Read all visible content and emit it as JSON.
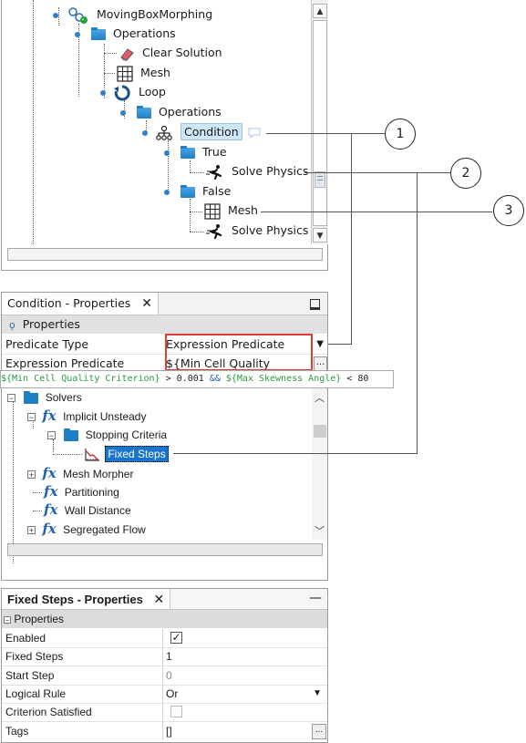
{
  "sim_tree": {
    "rows": [
      {
        "label": "MovingBoxMorphing"
      },
      {
        "label": "Operations"
      },
      {
        "label": "Clear Solution"
      },
      {
        "label": "Mesh"
      },
      {
        "label": "Loop"
      },
      {
        "label": "Operations"
      },
      {
        "label": "Condition"
      },
      {
        "label": "True"
      },
      {
        "label": "Solve Physics"
      },
      {
        "label": "False"
      },
      {
        "label": "Mesh"
      },
      {
        "label": "Solve Physics"
      }
    ]
  },
  "condition_props": {
    "tab_title": "Condition - Properties",
    "tab_close": "✕",
    "section": "Properties",
    "rows": [
      {
        "key": "Predicate Type",
        "value": "Expression Predicate"
      },
      {
        "key": "Expression Predicate",
        "value": "${Min Cell Quality Criterion"
      }
    ],
    "ellipsis": "...",
    "expression": {
      "part1": "${Min Cell Quality Criterion}",
      "part2": " > 0.001 ",
      "part3": "&&",
      "part4": " ${Max Skewness Angle}",
      "part5": " < 80"
    }
  },
  "object_tree": {
    "rows": [
      {
        "label": "Solvers"
      },
      {
        "label": "Implicit Unsteady"
      },
      {
        "label": "Stopping Criteria"
      },
      {
        "label": "Fixed Steps"
      },
      {
        "label": "Mesh Morpher"
      },
      {
        "label": "Partitioning"
      },
      {
        "label": "Wall Distance"
      },
      {
        "label": "Segregated Flow"
      }
    ],
    "fx": "fx"
  },
  "fixed_props": {
    "tab_title": "Fixed Steps - Properties",
    "tab_close": "✕",
    "minimize": "—",
    "section": "Properties",
    "rows": [
      {
        "key": "Enabled",
        "value": ""
      },
      {
        "key": "Fixed Steps",
        "value": "1"
      },
      {
        "key": "Start Step",
        "value": "0"
      },
      {
        "key": "Logical Rule",
        "value": "Or"
      },
      {
        "key": "Criterion Satisfied",
        "value": ""
      },
      {
        "key": "Tags",
        "value": "[]"
      }
    ],
    "ellipsis": "..."
  },
  "callouts": [
    "1",
    "2",
    "3"
  ]
}
